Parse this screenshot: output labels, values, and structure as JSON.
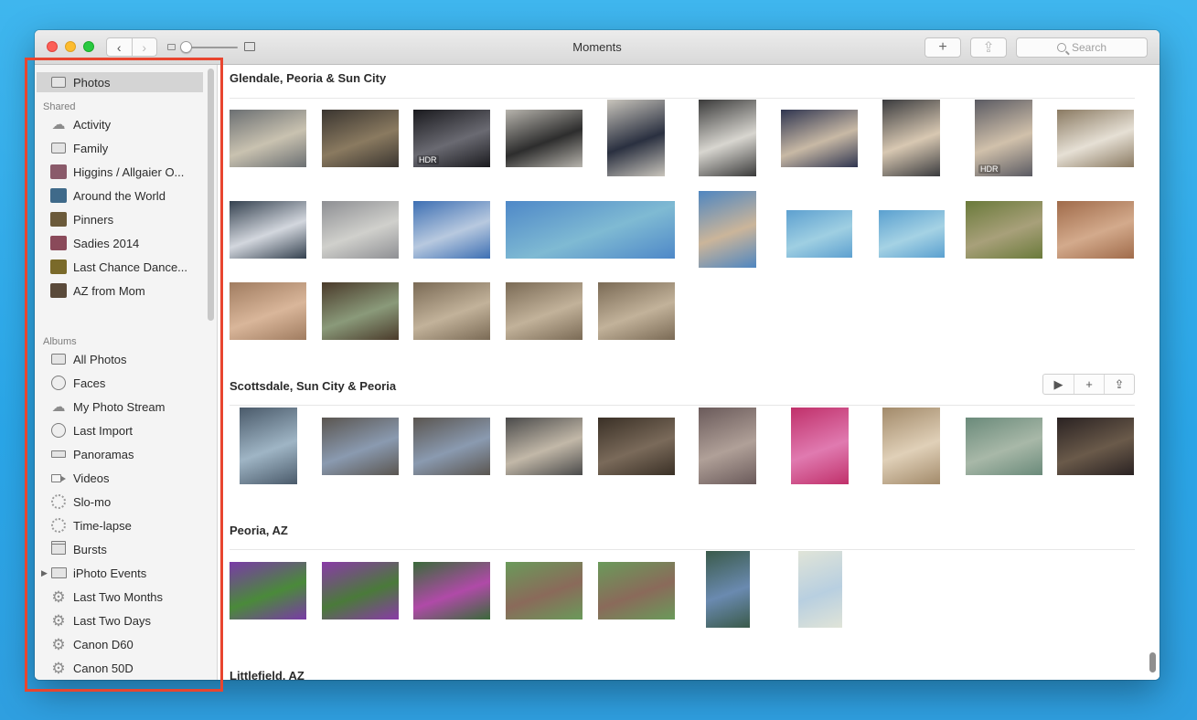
{
  "window": {
    "title": "Moments"
  },
  "toolbar": {
    "back": "‹",
    "forward": "›",
    "add": "+",
    "share": "⇪",
    "search_placeholder": "Search"
  },
  "sidebar": {
    "top": [
      {
        "label": "Photos",
        "icon": "photos-icon"
      }
    ],
    "shared_header": "Shared",
    "shared": [
      {
        "label": "Activity",
        "icon": "cloud-icon"
      },
      {
        "label": "Family",
        "icon": "shared-album-icon"
      },
      {
        "label": "Higgins / Allgaier O...",
        "icon": "album-thumbnail-icon",
        "color": "#8a5a6a"
      },
      {
        "label": "Around the World",
        "icon": "album-thumbnail-icon",
        "color": "#3f6a8a"
      },
      {
        "label": "Pinners",
        "icon": "album-thumbnail-icon",
        "color": "#6b5a3a"
      },
      {
        "label": "Sadies 2014",
        "icon": "album-thumbnail-icon",
        "color": "#8a4a5a"
      },
      {
        "label": "Last Chance Dance...",
        "icon": "album-thumbnail-icon",
        "color": "#7a6a2a"
      },
      {
        "label": "AZ from Mom",
        "icon": "album-thumbnail-icon",
        "color": "#5a4a3a"
      }
    ],
    "albums_header": "Albums",
    "albums": [
      {
        "label": "All Photos",
        "icon": "all-photos-icon"
      },
      {
        "label": "Faces",
        "icon": "faces-icon"
      },
      {
        "label": "My Photo Stream",
        "icon": "photo-stream-icon"
      },
      {
        "label": "Last Import",
        "icon": "last-import-icon"
      },
      {
        "label": "Panoramas",
        "icon": "panorama-icon"
      },
      {
        "label": "Videos",
        "icon": "video-icon"
      },
      {
        "label": "Slo-mo",
        "icon": "slo-mo-icon"
      },
      {
        "label": "Time-lapse",
        "icon": "time-lapse-icon"
      },
      {
        "label": "Bursts",
        "icon": "bursts-icon"
      },
      {
        "label": "iPhoto Events",
        "icon": "folder-icon",
        "disclosure": "▶"
      },
      {
        "label": "Last Two Months",
        "icon": "smart-album-gear-icon"
      },
      {
        "label": "Last Two Days",
        "icon": "smart-album-gear-icon"
      },
      {
        "label": "Canon D60",
        "icon": "smart-album-gear-icon"
      },
      {
        "label": "Canon 50D",
        "icon": "smart-album-gear-icon"
      }
    ]
  },
  "moments": [
    {
      "title": "Glendale, Peoria & Sun City"
    },
    {
      "title": "Scottsdale, Sun City & Peoria",
      "actions": [
        "▶",
        "+",
        "⇪"
      ]
    },
    {
      "title": "Peoria, AZ"
    },
    {
      "title": "Littlefield, AZ"
    }
  ],
  "badges": {
    "hdr": "HDR"
  },
  "colors": {
    "accent_highlight": "#e8452f",
    "sidebar_selection": "#d4d4d4"
  }
}
